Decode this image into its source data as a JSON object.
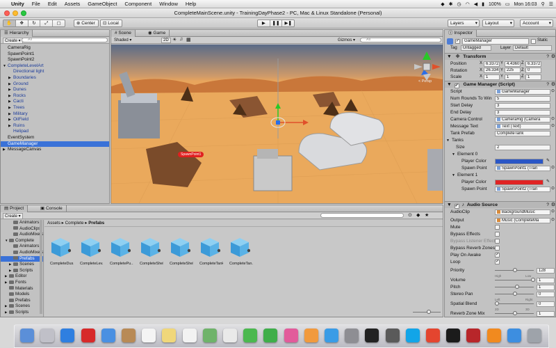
{
  "menubar": {
    "app": "Unity",
    "items": [
      "File",
      "Edit",
      "Assets",
      "GameObject",
      "Component",
      "Window",
      "Help"
    ],
    "clock": "Mon 16:03",
    "battery": "100%"
  },
  "window": {
    "title": "CompleteMainScene.unity - TrainingDayPhase2 - PC, Mac & Linux Standalone (Personal)"
  },
  "toolbar": {
    "center_label": "Center",
    "local_label": "Local",
    "layers_label": "Layers",
    "layout_label": "Layout",
    "account_label": "Account"
  },
  "hierarchy": {
    "tab": "Hierarchy",
    "create": "Create",
    "search_placeholder": "All",
    "items": [
      {
        "label": "CameraRig",
        "indent": 0,
        "style": "normal"
      },
      {
        "label": "SpawnPoint1",
        "indent": 0,
        "style": "normal"
      },
      {
        "label": "SpawnPoint2",
        "indent": 0,
        "style": "normal"
      },
      {
        "label": "CompleteLevelArt",
        "indent": 0,
        "style": "blue",
        "arrow": "▼"
      },
      {
        "label": "Directional light",
        "indent": 1,
        "style": "blue"
      },
      {
        "label": "Boundaries",
        "indent": 1,
        "style": "blue",
        "arrow": "▶"
      },
      {
        "label": "Ground",
        "indent": 1,
        "style": "blue",
        "arrow": "▶"
      },
      {
        "label": "Dunes",
        "indent": 1,
        "style": "blue",
        "arrow": "▶"
      },
      {
        "label": "Rocks",
        "indent": 1,
        "style": "blue",
        "arrow": "▶"
      },
      {
        "label": "Cacti",
        "indent": 1,
        "style": "blue",
        "arrow": "▶"
      },
      {
        "label": "Trees",
        "indent": 1,
        "style": "blue",
        "arrow": "▶"
      },
      {
        "label": "Military",
        "indent": 1,
        "style": "blue",
        "arrow": "▶"
      },
      {
        "label": "OilField",
        "indent": 1,
        "style": "blue",
        "arrow": "▶"
      },
      {
        "label": "Ruins",
        "indent": 1,
        "style": "blue",
        "arrow": "▶"
      },
      {
        "label": "Helipad",
        "indent": 1,
        "style": "blue"
      },
      {
        "label": "EventSystem",
        "indent": 0,
        "style": "normal"
      },
      {
        "label": "GameManager",
        "indent": 0,
        "style": "selected"
      },
      {
        "label": "MessageCanvas",
        "indent": 0,
        "style": "normal",
        "arrow": "▶"
      }
    ]
  },
  "scene": {
    "tab_scene": "Scene",
    "tab_game": "Game",
    "shading": "Shaded",
    "mode_2d": "2D",
    "gizmos": "Gizmos",
    "search_placeholder": "All",
    "persp": "< Persp",
    "spawn_label": "SpawnPoint1"
  },
  "inspector": {
    "tab": "Inspector",
    "object_name": "GameManager",
    "static_label": "Static",
    "tag_label": "Tag",
    "tag_value": "Untagged",
    "layer_label": "Layer",
    "layer_value": "Default",
    "transform": {
      "title": "Transform",
      "rows": [
        {
          "label": "Position",
          "x": "6.3372",
          "y": "4.4360",
          "z": "6.3372"
        },
        {
          "label": "Rotation",
          "x": "26.334",
          "y": "225",
          "z": "0"
        },
        {
          "label": "Scale",
          "x": "1",
          "y": "1",
          "z": "1"
        }
      ]
    },
    "game_manager": {
      "title": "Game Manager (Script)",
      "script_label": "Script",
      "script_value": "GameManager",
      "num_rounds_label": "Num Rounds To Win",
      "num_rounds_value": "5",
      "start_delay_label": "Start Delay",
      "start_delay_value": "3",
      "end_delay_label": "End Delay",
      "end_delay_value": "3",
      "camera_control_label": "Camera Control",
      "camera_control_value": "CameraRig (Camera",
      "message_text_label": "Message Text",
      "message_text_value": "Text (Text)",
      "tank_prefab_label": "Tank Prefab",
      "tank_prefab_value": "CompleteTank",
      "tanks_label": "Tanks",
      "size_label": "Size",
      "size_value": "2",
      "element0_label": "Element 0",
      "element1_label": "Element 1",
      "player_color_label": "Player Color",
      "spawn_point_label": "Spawn Point",
      "spawn0_value": "SpawnPoint1 (Tran",
      "spawn1_value": "SpawnPoint2 (Tran",
      "color0": "#2a56c6",
      "color1": "#e02323"
    },
    "audio": {
      "title": "Audio Source",
      "clip_label": "AudioClip",
      "clip_value": "BackgroundMusic",
      "output_label": "Output",
      "output_value": "Music (CompleteMa",
      "mute_label": "Mute",
      "bypass_effects_label": "Bypass Effects",
      "bypass_listener_label": "Bypass Listener Effect",
      "bypass_reverb_label": "Bypass Reverb Zones",
      "play_on_awake_label": "Play On Awake",
      "loop_label": "Loop",
      "priority_label": "Priority",
      "priority_value": "128",
      "priority_high": "High",
      "priority_low": "Low",
      "volume_label": "Volume",
      "volume_value": "1",
      "pitch_label": "Pitch",
      "pitch_value": "1",
      "stereo_pan_label": "Stereo Pan",
      "stereo_pan_value": "0",
      "pan_left": "Left",
      "pan_right": "Right",
      "spatial_blend_label": "Spatial Blend",
      "spatial_blend_value": "0",
      "blend_2d": "2D",
      "blend_3d": "3D",
      "reverb_zone_label": "Reverb Zone Mix",
      "reverb_zone_value": "1"
    }
  },
  "project": {
    "tab_project": "Project",
    "tab_console": "Console",
    "create": "Create",
    "breadcrumb": [
      "Assets",
      "Complete",
      "Prefabs"
    ],
    "folders": [
      {
        "label": "Animators",
        "indent": 2
      },
      {
        "label": "AudioClips",
        "indent": 2
      },
      {
        "label": "AudioMixers",
        "indent": 2
      },
      {
        "label": "Complete",
        "indent": 1,
        "arrow": "▼"
      },
      {
        "label": "Animators",
        "indent": 2
      },
      {
        "label": "AudioMixers",
        "indent": 2
      },
      {
        "label": "Prefabs",
        "indent": 2,
        "selected": true
      },
      {
        "label": "Scenes",
        "indent": 2,
        "arrow": "▶"
      },
      {
        "label": "Scripts",
        "indent": 2,
        "arrow": "▶"
      },
      {
        "label": "Editor",
        "indent": 1,
        "arrow": "▶"
      },
      {
        "label": "Fonts",
        "indent": 1,
        "arrow": "▶"
      },
      {
        "label": "Materials",
        "indent": 1
      },
      {
        "label": "Models",
        "indent": 1
      },
      {
        "label": "Prefabs",
        "indent": 1
      },
      {
        "label": "Scenes",
        "indent": 1,
        "arrow": "▶"
      },
      {
        "label": "Scripts",
        "indent": 1,
        "arrow": "▶"
      }
    ],
    "assets": [
      "CompleteDus...",
      "CompleteLev...",
      "CompletePu...",
      "CompleteShell",
      "CompleteShel...",
      "CompleteTank",
      "CompleteTan..."
    ]
  },
  "dock": {
    "icons": [
      "finder",
      "launchpad",
      "safari",
      "opera",
      "mail",
      "contacts",
      "calendar",
      "notes",
      "reminders",
      "maps",
      "photos",
      "messages",
      "facetime",
      "itunes",
      "ibooks",
      "appstore",
      "preferences",
      "unity",
      "monodevelop",
      "skype",
      "chrome",
      "terminal",
      "filezilla",
      "vlc",
      "xcode",
      "trash"
    ]
  }
}
